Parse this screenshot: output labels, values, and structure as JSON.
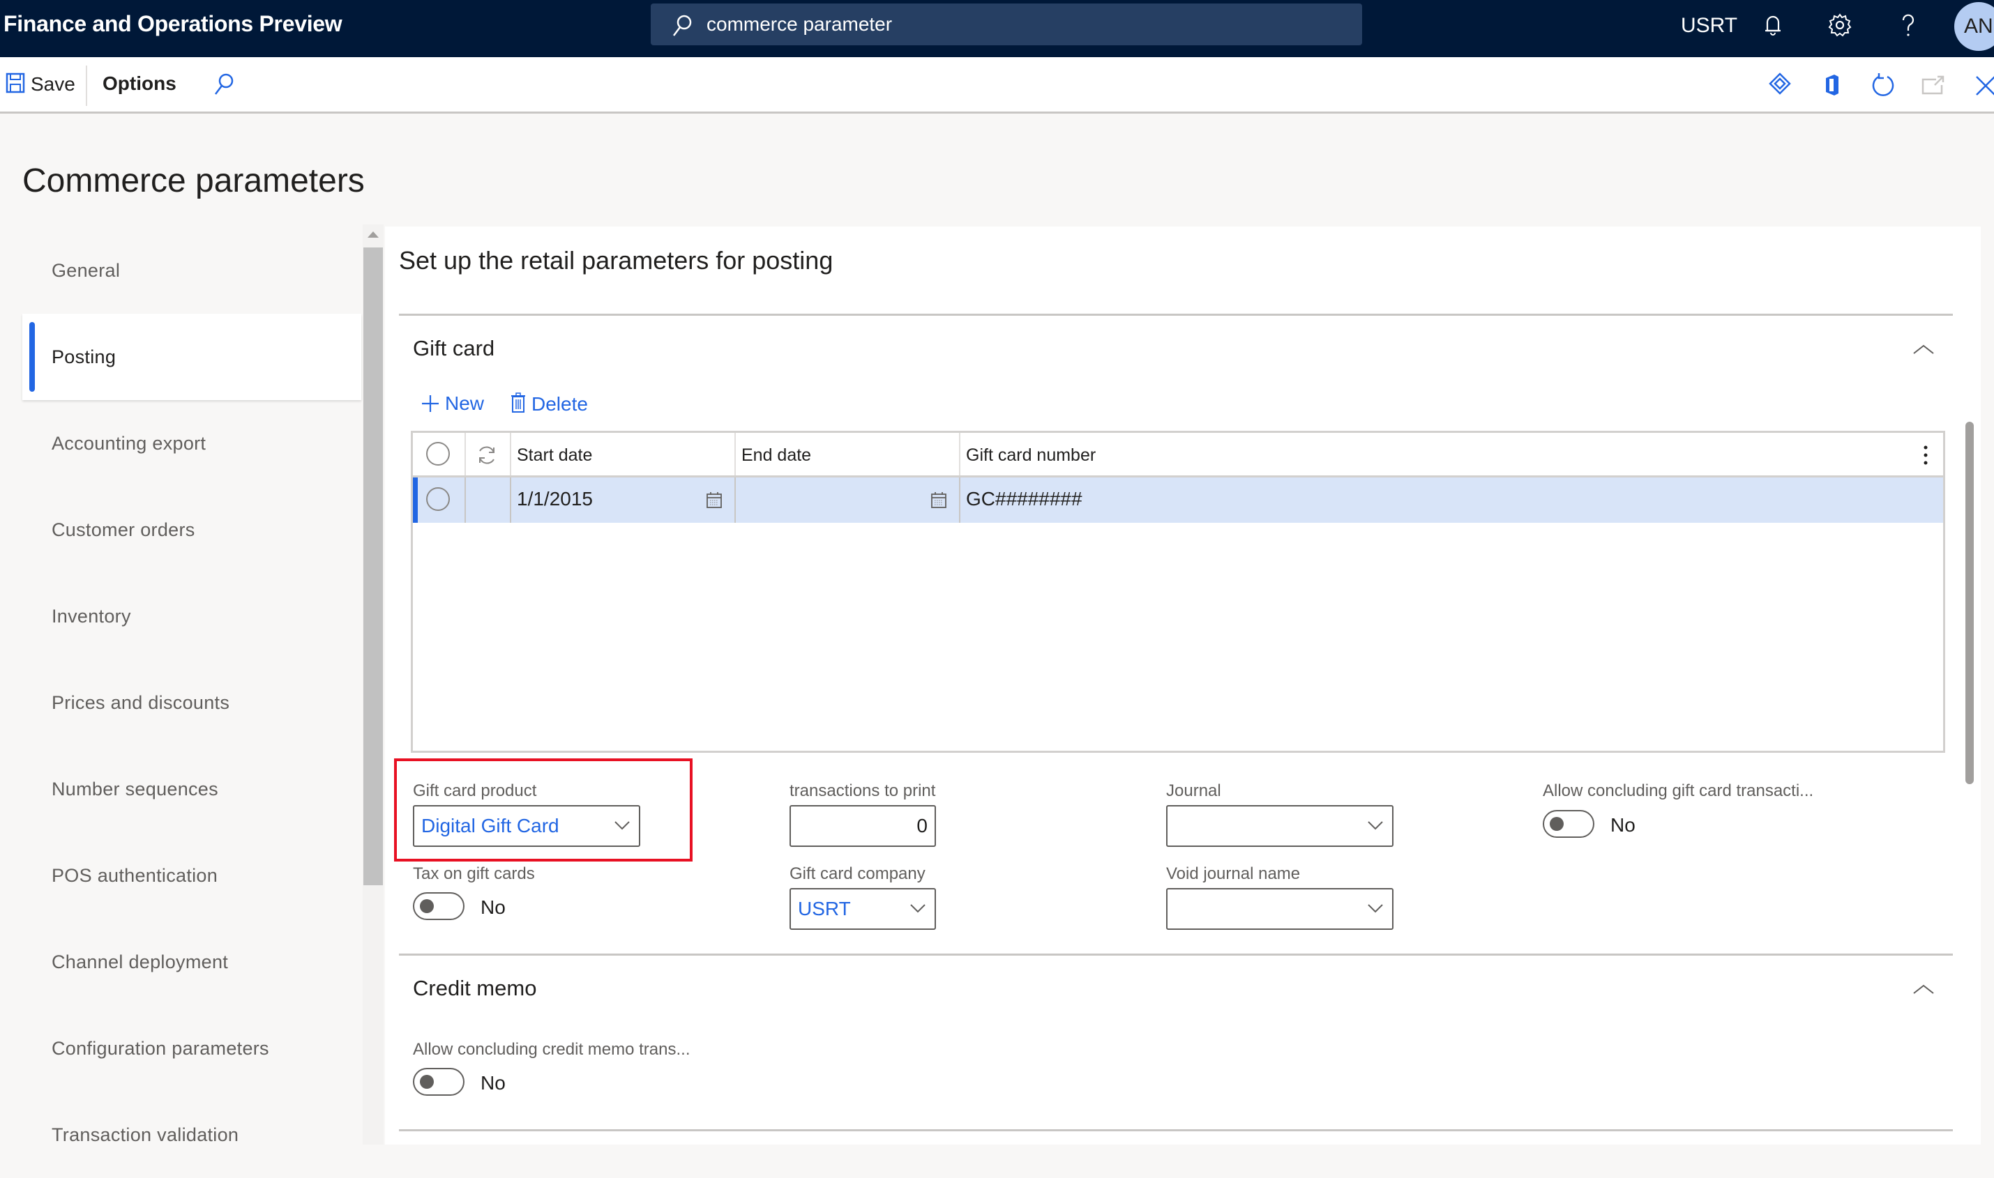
{
  "app": {
    "title": "Finance and Operations Preview",
    "search_value": "commerce parameter",
    "company": "USRT",
    "avatar_initials": "AN",
    "icons": [
      "search-icon",
      "bell-icon",
      "gear-icon",
      "help-icon"
    ]
  },
  "toolbar": {
    "save_label": "Save",
    "options_label": "Options",
    "right_icons": [
      "power-apps-icon",
      "office-icon",
      "refresh-icon",
      "open-new-window-icon",
      "close-icon"
    ]
  },
  "page": {
    "title": "Commerce parameters"
  },
  "sidebar": {
    "items": [
      {
        "label": "General",
        "selected": false
      },
      {
        "label": "Posting",
        "selected": true
      },
      {
        "label": "Accounting export",
        "selected": false
      },
      {
        "label": "Customer orders",
        "selected": false
      },
      {
        "label": "Inventory",
        "selected": false
      },
      {
        "label": "Prices and discounts",
        "selected": false
      },
      {
        "label": "Number sequences",
        "selected": false
      },
      {
        "label": "POS authentication",
        "selected": false
      },
      {
        "label": "Channel deployment",
        "selected": false
      },
      {
        "label": "Configuration parameters",
        "selected": false
      },
      {
        "label": "Transaction validation",
        "selected": false
      }
    ]
  },
  "main": {
    "heading": "Set up the retail parameters for posting",
    "gift_card": {
      "title": "Gift card",
      "actions": {
        "new_label": "New",
        "delete_label": "Delete"
      },
      "grid": {
        "columns": [
          "Start date",
          "End date",
          "Gift card number"
        ],
        "rows": [
          {
            "start_date": "1/1/2015",
            "end_date": "",
            "gift_card_number": "GC########"
          }
        ]
      },
      "fields": {
        "gift_card_product": {
          "label": "Gift card product",
          "value": "Digital Gift Card"
        },
        "transactions_to_print": {
          "label": "transactions to print",
          "value": "0"
        },
        "journal": {
          "label": "Journal",
          "value": ""
        },
        "allow_concluding": {
          "label": "Allow concluding gift card transacti...",
          "value": "No"
        },
        "tax_on_gift_cards": {
          "label": "Tax on gift cards",
          "value": "No"
        },
        "gift_card_company": {
          "label": "Gift card company",
          "value": "USRT"
        },
        "void_journal_name": {
          "label": "Void journal name",
          "value": ""
        }
      }
    },
    "credit_memo": {
      "title": "Credit memo",
      "fields": {
        "allow_concluding": {
          "label": "Allow concluding credit memo trans...",
          "value": "No"
        }
      }
    }
  },
  "colors": {
    "topbar": "#001838",
    "accent": "#2266e3",
    "selected_row": "#d8e4f8",
    "highlight": "#e81123"
  }
}
